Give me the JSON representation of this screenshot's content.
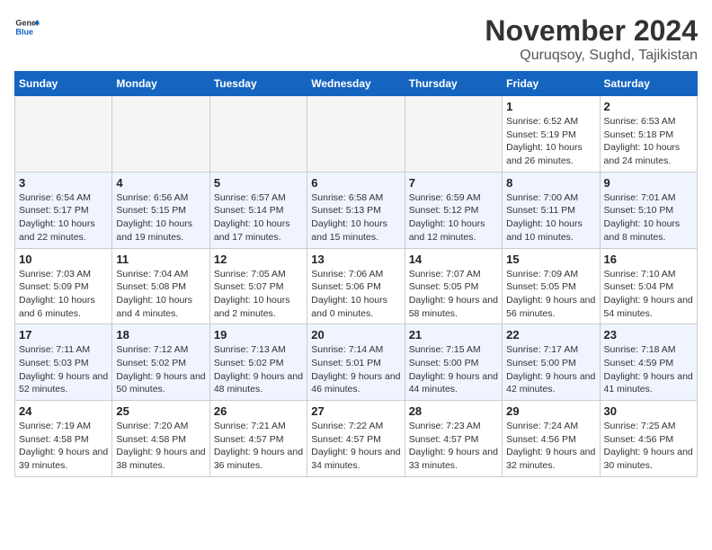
{
  "header": {
    "logo_line1": "General",
    "logo_line2": "Blue",
    "month": "November 2024",
    "location": "Quruqsoy, Sughd, Tajikistan"
  },
  "days_of_week": [
    "Sunday",
    "Monday",
    "Tuesday",
    "Wednesday",
    "Thursday",
    "Friday",
    "Saturday"
  ],
  "weeks": [
    [
      {
        "day": "",
        "empty": true
      },
      {
        "day": "",
        "empty": true
      },
      {
        "day": "",
        "empty": true
      },
      {
        "day": "",
        "empty": true
      },
      {
        "day": "",
        "empty": true
      },
      {
        "day": "1",
        "sunrise": "6:52 AM",
        "sunset": "5:19 PM",
        "daylight": "10 hours and 26 minutes."
      },
      {
        "day": "2",
        "sunrise": "6:53 AM",
        "sunset": "5:18 PM",
        "daylight": "10 hours and 24 minutes."
      }
    ],
    [
      {
        "day": "3",
        "sunrise": "6:54 AM",
        "sunset": "5:17 PM",
        "daylight": "10 hours and 22 minutes."
      },
      {
        "day": "4",
        "sunrise": "6:56 AM",
        "sunset": "5:15 PM",
        "daylight": "10 hours and 19 minutes."
      },
      {
        "day": "5",
        "sunrise": "6:57 AM",
        "sunset": "5:14 PM",
        "daylight": "10 hours and 17 minutes."
      },
      {
        "day": "6",
        "sunrise": "6:58 AM",
        "sunset": "5:13 PM",
        "daylight": "10 hours and 15 minutes."
      },
      {
        "day": "7",
        "sunrise": "6:59 AM",
        "sunset": "5:12 PM",
        "daylight": "10 hours and 12 minutes."
      },
      {
        "day": "8",
        "sunrise": "7:00 AM",
        "sunset": "5:11 PM",
        "daylight": "10 hours and 10 minutes."
      },
      {
        "day": "9",
        "sunrise": "7:01 AM",
        "sunset": "5:10 PM",
        "daylight": "10 hours and 8 minutes."
      }
    ],
    [
      {
        "day": "10",
        "sunrise": "7:03 AM",
        "sunset": "5:09 PM",
        "daylight": "10 hours and 6 minutes."
      },
      {
        "day": "11",
        "sunrise": "7:04 AM",
        "sunset": "5:08 PM",
        "daylight": "10 hours and 4 minutes."
      },
      {
        "day": "12",
        "sunrise": "7:05 AM",
        "sunset": "5:07 PM",
        "daylight": "10 hours and 2 minutes."
      },
      {
        "day": "13",
        "sunrise": "7:06 AM",
        "sunset": "5:06 PM",
        "daylight": "10 hours and 0 minutes."
      },
      {
        "day": "14",
        "sunrise": "7:07 AM",
        "sunset": "5:05 PM",
        "daylight": "9 hours and 58 minutes."
      },
      {
        "day": "15",
        "sunrise": "7:09 AM",
        "sunset": "5:05 PM",
        "daylight": "9 hours and 56 minutes."
      },
      {
        "day": "16",
        "sunrise": "7:10 AM",
        "sunset": "5:04 PM",
        "daylight": "9 hours and 54 minutes."
      }
    ],
    [
      {
        "day": "17",
        "sunrise": "7:11 AM",
        "sunset": "5:03 PM",
        "daylight": "9 hours and 52 minutes."
      },
      {
        "day": "18",
        "sunrise": "7:12 AM",
        "sunset": "5:02 PM",
        "daylight": "9 hours and 50 minutes."
      },
      {
        "day": "19",
        "sunrise": "7:13 AM",
        "sunset": "5:02 PM",
        "daylight": "9 hours and 48 minutes."
      },
      {
        "day": "20",
        "sunrise": "7:14 AM",
        "sunset": "5:01 PM",
        "daylight": "9 hours and 46 minutes."
      },
      {
        "day": "21",
        "sunrise": "7:15 AM",
        "sunset": "5:00 PM",
        "daylight": "9 hours and 44 minutes."
      },
      {
        "day": "22",
        "sunrise": "7:17 AM",
        "sunset": "5:00 PM",
        "daylight": "9 hours and 42 minutes."
      },
      {
        "day": "23",
        "sunrise": "7:18 AM",
        "sunset": "4:59 PM",
        "daylight": "9 hours and 41 minutes."
      }
    ],
    [
      {
        "day": "24",
        "sunrise": "7:19 AM",
        "sunset": "4:58 PM",
        "daylight": "9 hours and 39 minutes."
      },
      {
        "day": "25",
        "sunrise": "7:20 AM",
        "sunset": "4:58 PM",
        "daylight": "9 hours and 38 minutes."
      },
      {
        "day": "26",
        "sunrise": "7:21 AM",
        "sunset": "4:57 PM",
        "daylight": "9 hours and 36 minutes."
      },
      {
        "day": "27",
        "sunrise": "7:22 AM",
        "sunset": "4:57 PM",
        "daylight": "9 hours and 34 minutes."
      },
      {
        "day": "28",
        "sunrise": "7:23 AM",
        "sunset": "4:57 PM",
        "daylight": "9 hours and 33 minutes."
      },
      {
        "day": "29",
        "sunrise": "7:24 AM",
        "sunset": "4:56 PM",
        "daylight": "9 hours and 32 minutes."
      },
      {
        "day": "30",
        "sunrise": "7:25 AM",
        "sunset": "4:56 PM",
        "daylight": "9 hours and 30 minutes."
      }
    ]
  ]
}
